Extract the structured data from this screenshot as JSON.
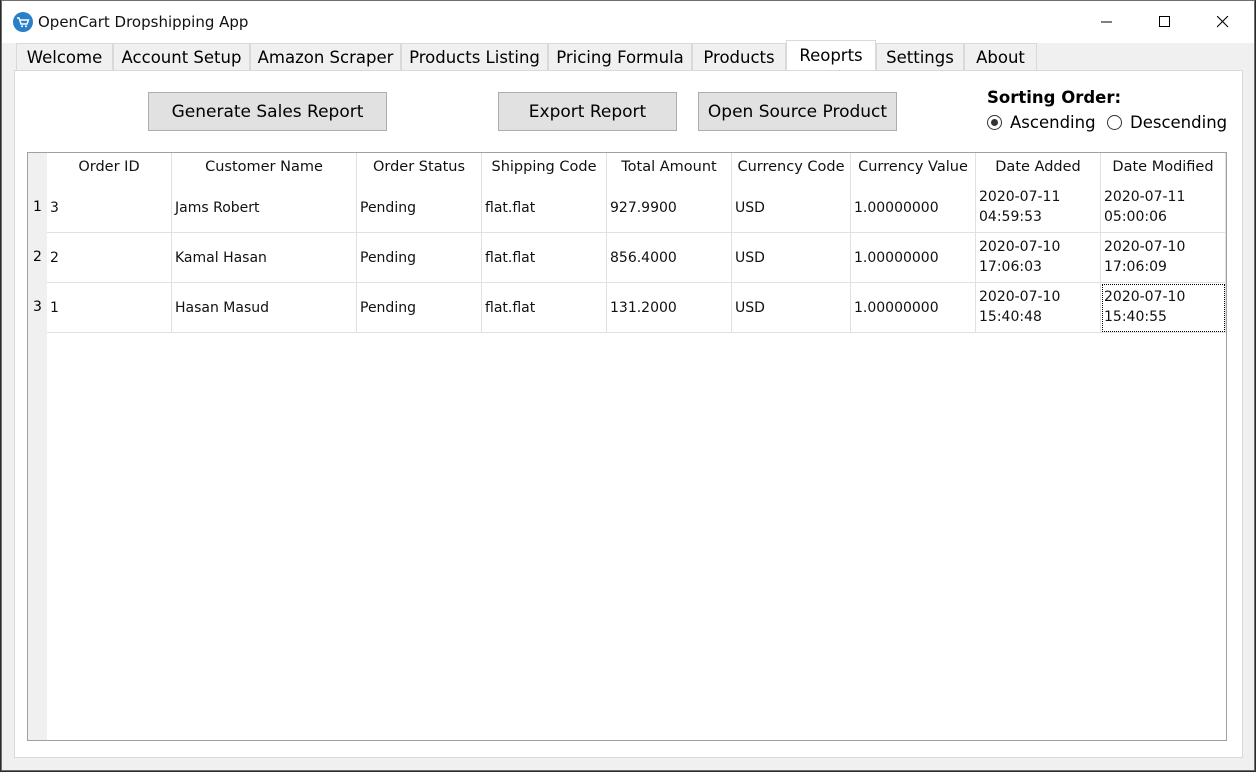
{
  "window": {
    "title": "OpenCart Dropshipping App"
  },
  "tabs": [
    {
      "label": "Welcome"
    },
    {
      "label": "Account Setup"
    },
    {
      "label": "Amazon Scraper"
    },
    {
      "label": "Products Listing"
    },
    {
      "label": "Pricing Formula"
    },
    {
      "label": "Products"
    },
    {
      "label": "Reoprts"
    },
    {
      "label": "Settings"
    },
    {
      "label": "About"
    }
  ],
  "active_tab": "Reoprts",
  "buttons": {
    "generate": "Generate Sales Report",
    "export": "Export Report",
    "open_source": "Open Source Product"
  },
  "sorting": {
    "label": "Sorting Order:",
    "options": [
      {
        "label": "Ascending",
        "checked": true
      },
      {
        "label": "Descending",
        "checked": false
      }
    ]
  },
  "table": {
    "columns": [
      "Order ID",
      "Customer Name",
      "Order Status",
      "Shipping Code",
      "Total Amount",
      "Currency Code",
      "Currency Value",
      "Date Added",
      "Date Modified"
    ],
    "rows": [
      {
        "num": "1",
        "cells": [
          "3",
          "Jams Robert",
          "Pending",
          "flat.flat",
          "927.9900",
          "USD",
          "1.00000000"
        ],
        "date_added": [
          "2020-07-11",
          "04:59:53"
        ],
        "date_modified": [
          "2020-07-11",
          "05:00:06"
        ]
      },
      {
        "num": "2",
        "cells": [
          "2",
          "Kamal Hasan",
          "Pending",
          "flat.flat",
          "856.4000",
          "USD",
          "1.00000000"
        ],
        "date_added": [
          "2020-07-10",
          "17:06:03"
        ],
        "date_modified": [
          "2020-07-10",
          "17:06:09"
        ]
      },
      {
        "num": "3",
        "cells": [
          "1",
          "Hasan Masud",
          "Pending",
          "flat.flat",
          "131.2000",
          "USD",
          "1.00000000"
        ],
        "date_added": [
          "2020-07-10",
          "15:40:48"
        ],
        "date_modified": [
          "2020-07-10",
          "15:40:55"
        ]
      }
    ]
  }
}
